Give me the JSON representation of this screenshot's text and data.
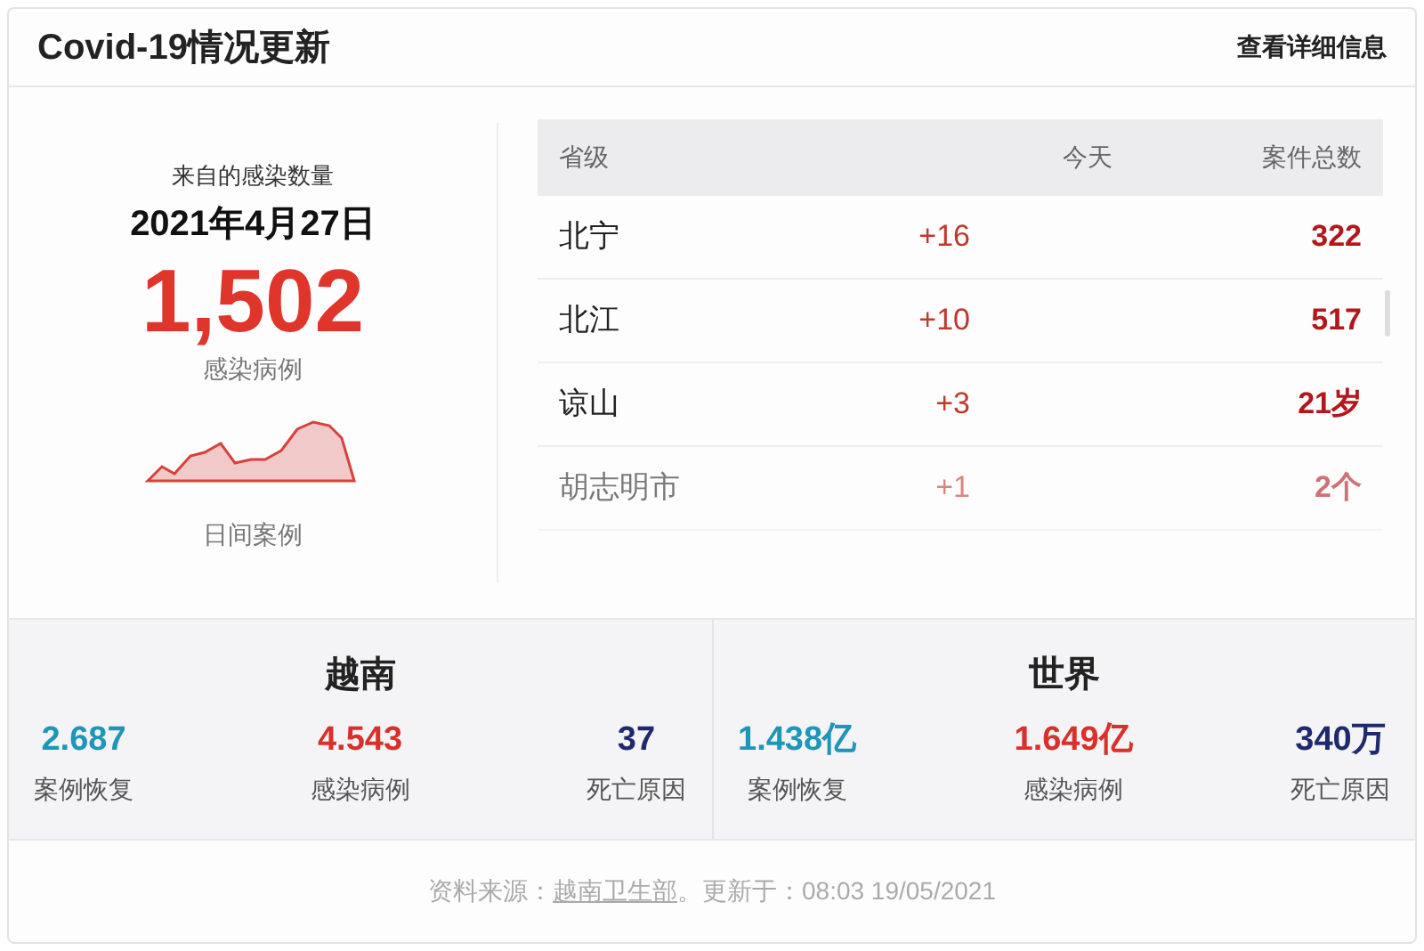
{
  "header": {
    "title": "Covid-19情况更新",
    "link": "查看详细信息"
  },
  "summary": {
    "caption": "来自的感染数量",
    "date": "2021年4月27日",
    "count": "1,502",
    "count_label": "感染病例",
    "sparkline_label": "日间案例"
  },
  "table": {
    "columns": [
      "省级",
      "今天",
      "案件总数"
    ],
    "rows": [
      {
        "province": "北宁",
        "today": "+16",
        "total": "322",
        "faded": false
      },
      {
        "province": "北江",
        "today": "+10",
        "total": "517",
        "faded": false
      },
      {
        "province": "谅山",
        "today": "+3",
        "total": "21岁",
        "faded": false
      },
      {
        "province": "胡志明市",
        "today": "+1",
        "total": "2个",
        "faded": true
      }
    ]
  },
  "regions": [
    {
      "title": "越南",
      "stats": [
        {
          "value": "2.687",
          "label": "案例恢复",
          "color": "#1e96b8"
        },
        {
          "value": "4.543",
          "label": "感染病例",
          "color": "#d9302c"
        },
        {
          "value": "37",
          "label": "死亡原因",
          "color": "#1f2a6e"
        }
      ]
    },
    {
      "title": "世界",
      "stats": [
        {
          "value": "1.438亿",
          "label": "案例恢复",
          "color": "#1e96b8"
        },
        {
          "value": "1.649亿",
          "label": "感染病例",
          "color": "#d9302c"
        },
        {
          "value": "340万",
          "label": "死亡原因",
          "color": "#1f2a6e"
        }
      ]
    }
  ],
  "footer": {
    "prefix": "资料来源：",
    "source": "越南卫生部",
    "suffix": "。更新于：08:03 19/05/2021"
  }
}
